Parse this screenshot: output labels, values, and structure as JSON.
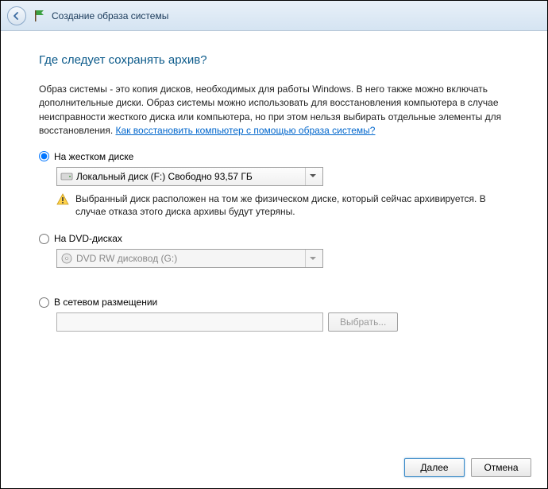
{
  "window": {
    "title": "Создание образа системы"
  },
  "heading": "Где следует сохранять архив?",
  "description_prefix": "Образ системы - это копия дисков, необходимых для работы Windows. В него также можно включать дополнительные диски. Образ системы можно использовать для восстановления компьютера в случае неисправности жесткого диска или компьютера, но при этом нельзя выбирать отдельные элементы для восстановления. ",
  "description_link": "Как восстановить компьютер с помощью образа системы?",
  "options": {
    "hdd": {
      "label": "На жестком диске",
      "selected": "Локальный диск (F:)  Свободно 93,57 ГБ",
      "warning": "Выбранный диск расположен на том же физическом диске, который сейчас архивируется. В случае отказа этого диска архивы будут утеряны."
    },
    "dvd": {
      "label": "На DVD-дисках",
      "selected": "DVD RW дисковод (G:)"
    },
    "network": {
      "label": "В сетевом размещении",
      "value": "",
      "browse": "Выбрать..."
    }
  },
  "footer": {
    "next": "Далее",
    "cancel": "Отмена"
  }
}
